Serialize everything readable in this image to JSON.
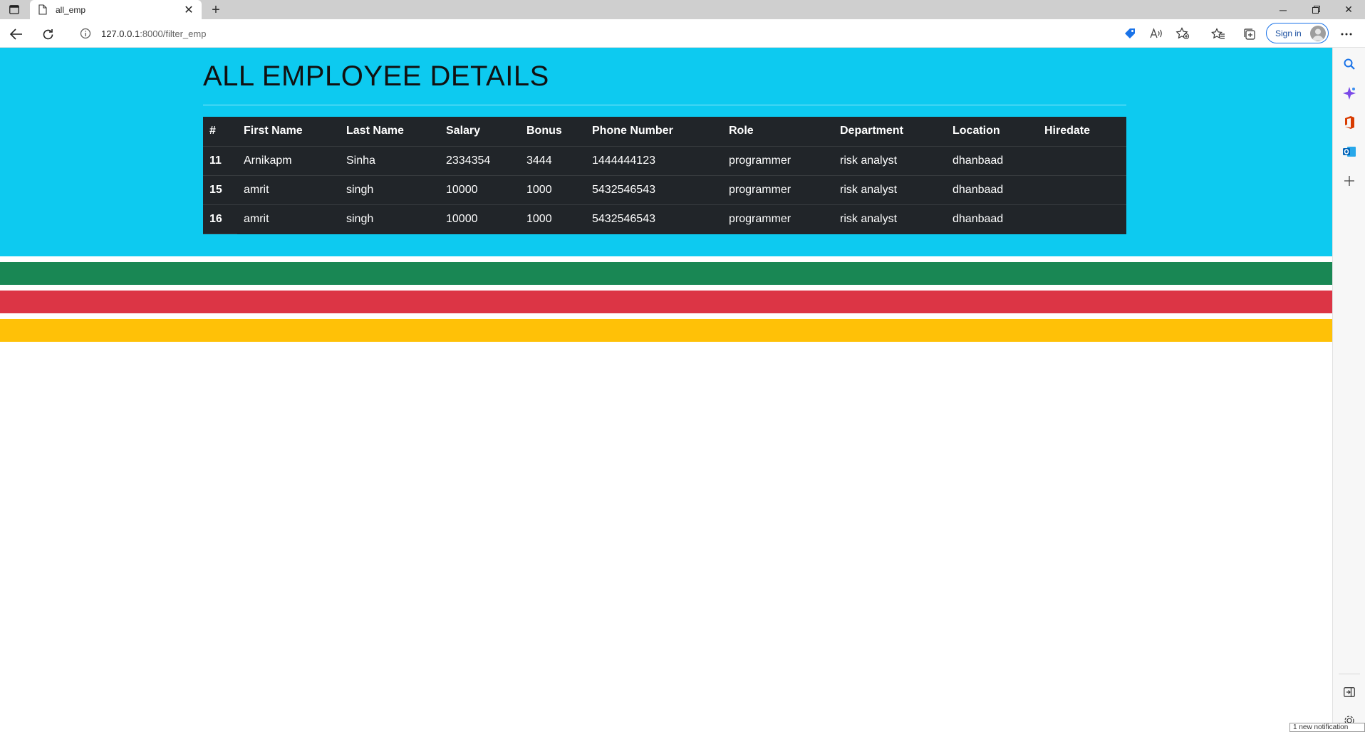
{
  "browser": {
    "tab_title": "all_emp",
    "url_host": "127.0.0.1",
    "url_rest": ":8000/filter_emp",
    "signin_label": "Sign in",
    "notification": "1 new notification"
  },
  "page": {
    "heading": "ALL EMPLOYEE DETAILS",
    "columns": [
      "#",
      "First Name",
      "Last Name",
      "Salary",
      "Bonus",
      "Phone Number",
      "Role",
      "Department",
      "Location",
      "Hiredate"
    ],
    "rows": [
      [
        "11",
        "Arnikapm",
        "Sinha",
        "2334354",
        "3444",
        "1444444123",
        "programmer",
        "risk analyst",
        "dhanbaad",
        ""
      ],
      [
        "15",
        "amrit",
        "singh",
        "10000",
        "1000",
        "5432546543",
        "programmer",
        "risk analyst",
        "dhanbaad",
        ""
      ],
      [
        "16",
        "amrit",
        "singh",
        "10000",
        "1000",
        "5432546543",
        "programmer",
        "risk analyst",
        "dhanbaad",
        ""
      ]
    ]
  },
  "colors": {
    "hero": "#0dcaf0",
    "table": "#212529",
    "stripe_green": "#198754",
    "stripe_red": "#dc3545",
    "stripe_yellow": "#ffc107"
  }
}
